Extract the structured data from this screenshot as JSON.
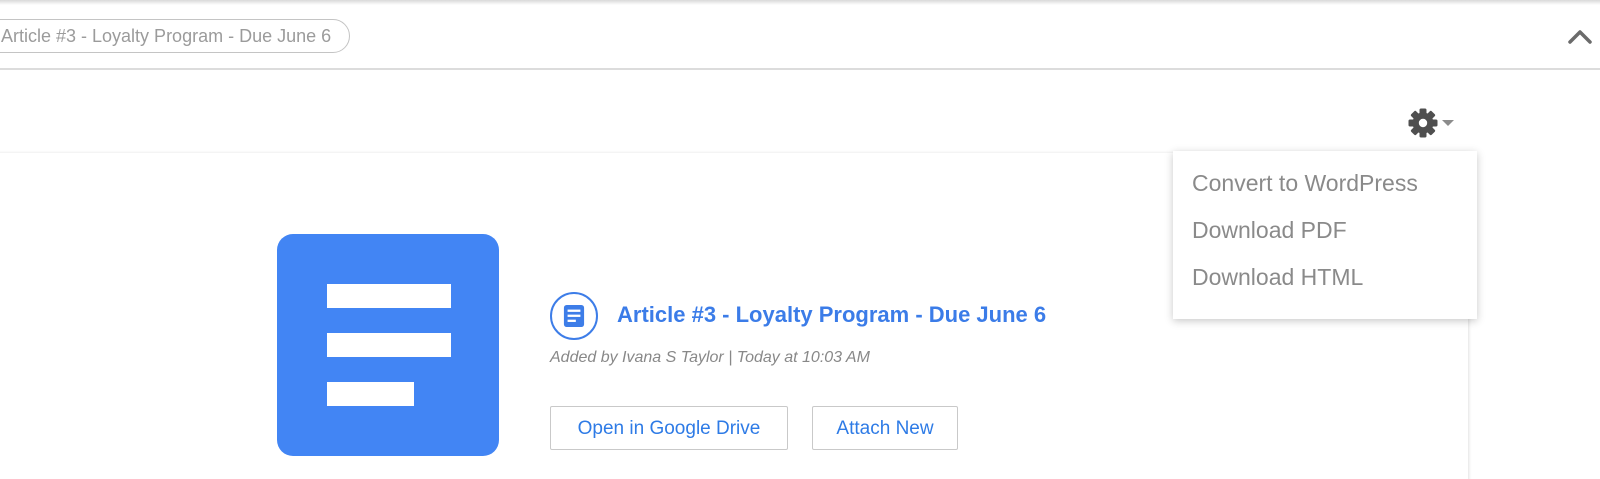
{
  "tag_bar": {
    "tag_label": "Article #3 - Loyalty Program - Due June 6"
  },
  "card": {
    "doc_title": "Article #3 - Loyalty Program - Due June 6",
    "doc_meta": "Added by Ivana S Taylor | Today at 10:03 AM",
    "open_drive_label": "Open in Google Drive",
    "attach_new_label": "Attach New"
  },
  "settings_menu": {
    "items": [
      {
        "label": "Convert to WordPress"
      },
      {
        "label": "Download PDF"
      },
      {
        "label": "Download HTML"
      }
    ]
  },
  "colors": {
    "accent": "#3b7ce8",
    "doc_blue": "#4285f4",
    "muted_text": "#8a8a8a"
  },
  "icons": [
    "chevron-up-icon",
    "gear-icon",
    "caret-down-icon",
    "google-docs-icon",
    "document-icon"
  ]
}
